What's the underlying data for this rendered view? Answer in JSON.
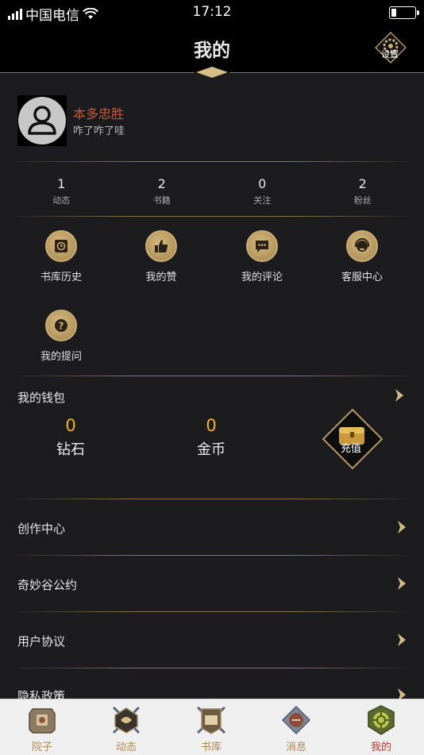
{
  "status_bar": {
    "carrier": "中国电信",
    "time": "17:12"
  },
  "header": {
    "title": "我的",
    "settings_label": "设置"
  },
  "profile": {
    "name": "本多忠胜",
    "signature": "咋了咋了哇"
  },
  "stats": [
    {
      "value": "1",
      "label": "动态"
    },
    {
      "value": "2",
      "label": "书籍"
    },
    {
      "value": "0",
      "label": "关注"
    },
    {
      "value": "2",
      "label": "粉丝"
    }
  ],
  "shortcuts": [
    {
      "label": "书库历史",
      "icon": "book-history-icon"
    },
    {
      "label": "我的赞",
      "icon": "thumbs-up-icon"
    },
    {
      "label": "我的评论",
      "icon": "comment-icon"
    },
    {
      "label": "客服中心",
      "icon": "headset-icon"
    },
    {
      "label": "我的提问",
      "icon": "question-icon"
    }
  ],
  "wallet": {
    "title": "我的钱包",
    "diamonds": {
      "value": "0",
      "label": "钻石"
    },
    "coins": {
      "value": "0",
      "label": "金币"
    },
    "recharge_label": "充值"
  },
  "menu": [
    {
      "label": "创作中心"
    },
    {
      "label": "奇妙谷公约"
    },
    {
      "label": "用户协议"
    },
    {
      "label": "隐私政策"
    }
  ],
  "tabs": [
    {
      "label": "院子",
      "icon": "courtyard-icon"
    },
    {
      "label": "动态",
      "icon": "feed-icon"
    },
    {
      "label": "书库",
      "icon": "library-icon"
    },
    {
      "label": "消息",
      "icon": "message-icon"
    },
    {
      "label": "我的",
      "icon": "profile-icon",
      "active": true
    }
  ],
  "colors": {
    "accent_gold": "#c9ad72",
    "username": "#c6573a",
    "currency": "#f4b31e",
    "active_tab": "#c0392b"
  }
}
